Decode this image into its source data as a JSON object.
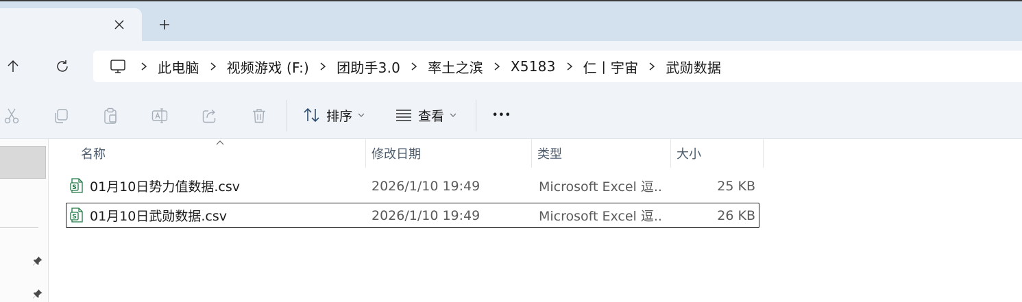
{
  "tabbar": {
    "close_glyph": "✕",
    "new_tab_glyph": "+"
  },
  "breadcrumb": {
    "items": [
      "此电脑",
      "视频游戏 (F:)",
      "团助手3.0",
      "率土之滨",
      "X5183",
      "仁丨宇宙",
      "武勋数据"
    ]
  },
  "toolbar": {
    "sort_label": "排序",
    "view_label": "查看",
    "more_glyph": "•••"
  },
  "columns": {
    "name": "名称",
    "modified": "修改日期",
    "type": "类型",
    "size": "大小"
  },
  "files": [
    {
      "name": "01月10日势力值数据.csv",
      "modified": "2026/1/10 19:49",
      "type": "Microsoft Excel 逗...",
      "size": "25 KB",
      "selected": false
    },
    {
      "name": "01月10日武勋数据.csv",
      "modified": "2026/1/10 19:49",
      "type": "Microsoft Excel 逗...",
      "size": "26 KB",
      "selected": true
    }
  ],
  "colors": {
    "tab_strip": "#d3e1ee",
    "chrome": "#f0f4f9",
    "excel_green": "#1d7a45"
  }
}
